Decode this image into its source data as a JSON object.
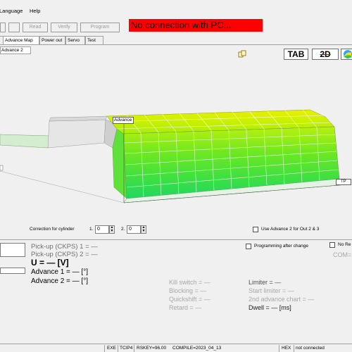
{
  "menu": {
    "language": "Language",
    "help": "Help"
  },
  "toolbar": {
    "read": "Read",
    "verify": "Verify",
    "program": "Program"
  },
  "connection_status": "No connection with PC...",
  "tabs": [
    "Advance Map",
    "Power out",
    "Servo",
    "Test"
  ],
  "subtab": "Advance 2",
  "view_buttons": {
    "tab": "TAB",
    "two_d": "2D",
    "three_d": "3"
  },
  "chart": {
    "axis_label_advance": "Advance",
    "axis_label_tp": "TP"
  },
  "correction": {
    "label": "Correction for cylinder",
    "cyl1_label": "1.",
    "cyl1_value": "0",
    "cyl2_label": "2.",
    "cyl2_value": "0",
    "use_advance2_label": "Use Advance 2 for Out 2 & 3"
  },
  "readouts": {
    "pickup1": "Pick-up (CKPS) 1 = —",
    "pickup2": "Pick-up (CKPS) 2 = —",
    "voltage": "U = — [V]",
    "advance1": "Advance 1 = — [°]",
    "advance2": "Advance 2 = — [°]",
    "programming_after_change": "Programming after change",
    "no_re": "No Re",
    "com": "COM="
  },
  "status_fields": {
    "kill_switch": "Kill switch = —",
    "blocking": "Blocking = —",
    "quickshift": "Quickshift = —",
    "retard": "Retard = —",
    "limiter": "Limiter = —",
    "start_limiter": "Start limiter = —",
    "second_advance_chart": "2nd advance chart = —",
    "dwell": "Dwell = — [ms]"
  },
  "statusbar": {
    "exe": "EXE",
    "tcip": "TCIP4",
    "rskey": "RSKEY=96.00",
    "compile": "COMPILE=2023_04_13",
    "hex": "HEX",
    "state": "not connected"
  }
}
